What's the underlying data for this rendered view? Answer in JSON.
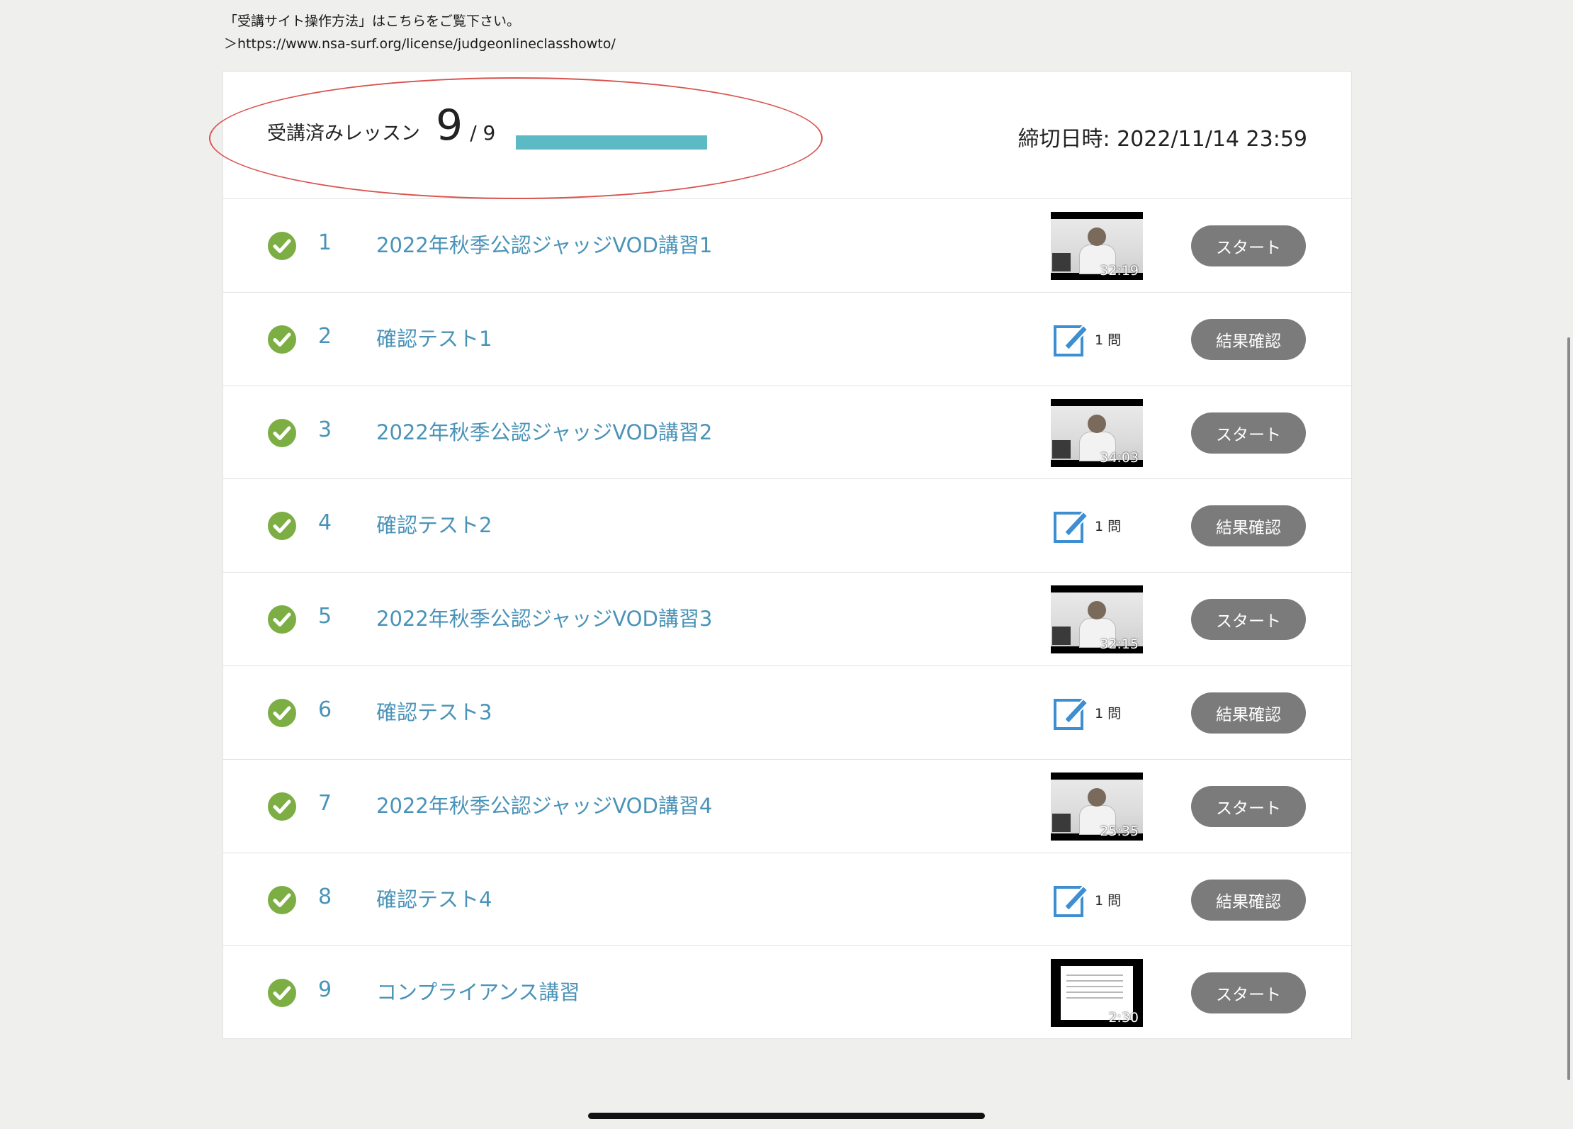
{
  "notice": {
    "line1": "「受講サイト操作方法」はこちらをご覧下さい。",
    "line2": "＞https://www.nsa-surf.org/license/judgeonlineclasshowto/"
  },
  "progress": {
    "label": "受講済みレッスン",
    "completed": "9",
    "total": "/ 9",
    "fraction": 1.0,
    "bar_color": "#5bbac4"
  },
  "deadline": {
    "text": "締切日時: 2022/11/14 23:59"
  },
  "colors": {
    "check": "#7cae44",
    "link": "#4a93b8",
    "button": "#7b7b7b",
    "quiz_icon": "#3d8fd1",
    "annotation": "#d9534f"
  },
  "lessons": [
    {
      "num": "1",
      "title": "2022年秋季公認ジャッジVOD講習1",
      "kind": "video",
      "duration": "32:19",
      "button": "スタート"
    },
    {
      "num": "2",
      "title": "確認テスト1",
      "kind": "quiz",
      "questions": "1 問",
      "button": "結果確認"
    },
    {
      "num": "3",
      "title": "2022年秋季公認ジャッジVOD講習2",
      "kind": "video",
      "duration": "34:03",
      "button": "スタート"
    },
    {
      "num": "4",
      "title": "確認テスト2",
      "kind": "quiz",
      "questions": "1 問",
      "button": "結果確認"
    },
    {
      "num": "5",
      "title": "2022年秋季公認ジャッジVOD講習3",
      "kind": "video",
      "duration": "32:15",
      "button": "スタート"
    },
    {
      "num": "6",
      "title": "確認テスト3",
      "kind": "quiz",
      "questions": "1 問",
      "button": "結果確認"
    },
    {
      "num": "7",
      "title": "2022年秋季公認ジャッジVOD講習4",
      "kind": "video",
      "duration": "25:35",
      "button": "スタート"
    },
    {
      "num": "8",
      "title": "確認テスト4",
      "kind": "quiz",
      "questions": "1 問",
      "button": "結果確認"
    },
    {
      "num": "9",
      "title": "コンプライアンス講習",
      "kind": "slide",
      "duration": "2:30",
      "button": "スタート"
    }
  ]
}
